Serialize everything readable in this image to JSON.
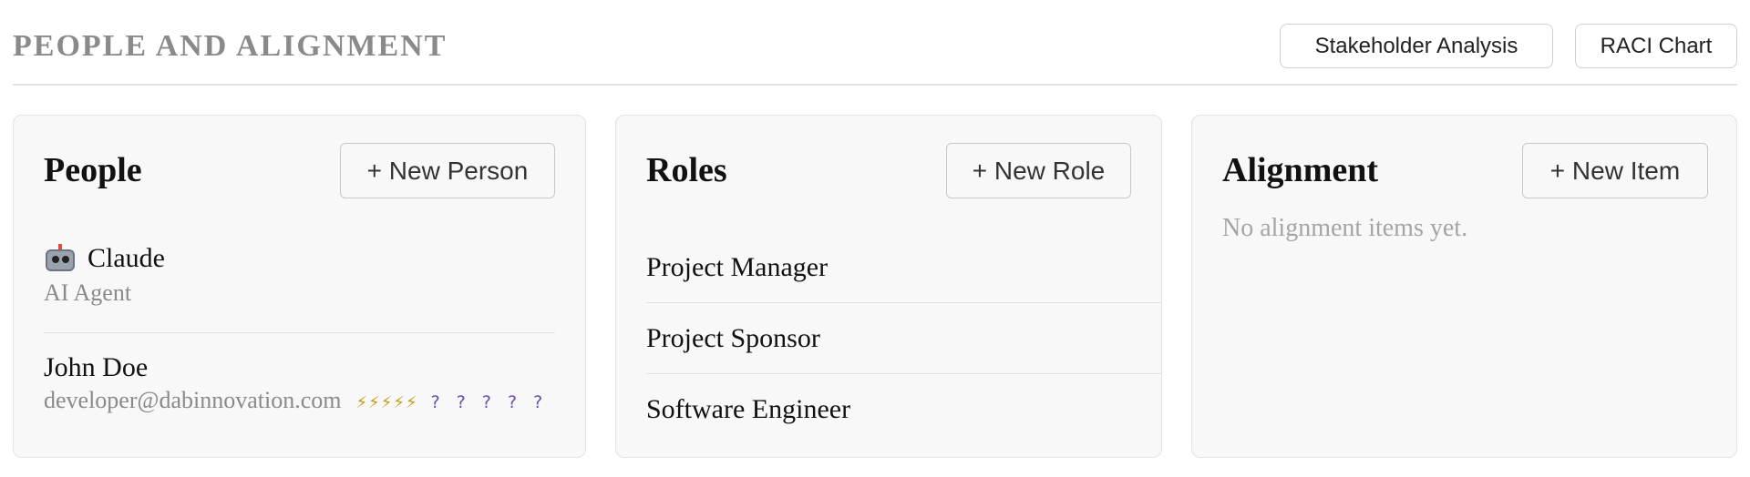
{
  "header": {
    "title": "PEOPLE AND ALIGNMENT",
    "stakeholder_button": "Stakeholder Analysis",
    "raci_button": "RACI Chart"
  },
  "people": {
    "title": "People",
    "new_button": "+ New Person",
    "items": [
      {
        "icon": "robot-icon",
        "name": "Claude",
        "subtitle": "AI Agent"
      },
      {
        "name": "John Doe",
        "email": "developer@dabinnovation.com",
        "bolts": "⚡⚡⚡⚡⚡",
        "unknown": "? ? ? ? ?"
      }
    ]
  },
  "roles": {
    "title": "Roles",
    "new_button": "+ New Role",
    "items": [
      {
        "label": "Project Manager"
      },
      {
        "label": "Project Sponsor"
      },
      {
        "label": "Software Engineer"
      }
    ]
  },
  "alignment": {
    "title": "Alignment",
    "new_button": "+ New Item",
    "empty_text": "No alignment items yet."
  }
}
